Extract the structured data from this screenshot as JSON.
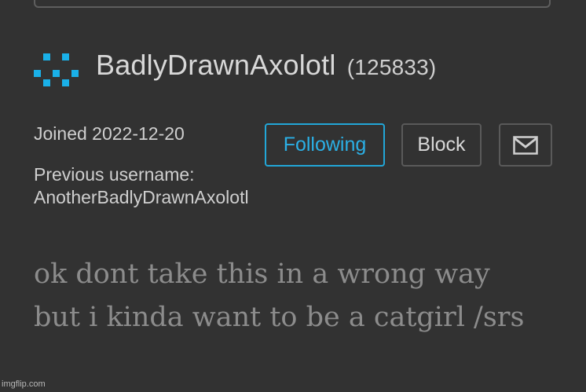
{
  "profile": {
    "username": "BadlyDrawnAxolotl",
    "user_id": "(125833)",
    "joined": "Joined 2022-12-20",
    "previous_username_label": "Previous username:",
    "previous_username": "AnotherBadlyDrawnAxolotl",
    "bio": "ok dont take this in a wrong way but i kinda want to be a catgirl /srs"
  },
  "actions": {
    "follow_label": "Following",
    "block_label": "Block",
    "message_icon": "mail-icon"
  },
  "avatar": {
    "icon": "pixel-avatar-icon",
    "color": "#1ab0e8"
  },
  "watermark": "imgflip.com",
  "colors": {
    "background": "#323232",
    "accent": "#22a7d8",
    "text": "#d8d8d8",
    "bio_text": "#8c8c8c",
    "border": "#5a5a5a"
  }
}
